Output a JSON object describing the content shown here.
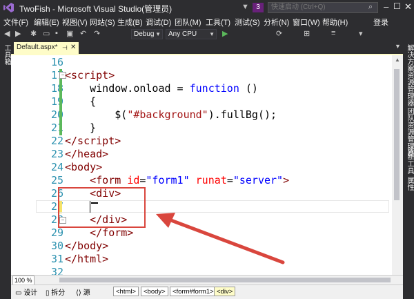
{
  "window": {
    "title": "TwoFish - Microsoft Visual Studio(管理员)",
    "notification_count": "3",
    "quick_launch_placeholder": "快速启动 (Ctrl+Q)"
  },
  "menu": {
    "items": [
      "文件(F)",
      "编辑(E)",
      "视图(V)",
      "网站(S)",
      "生成(B)",
      "调试(D)",
      "团队(M)",
      "工具(T)",
      "测试(S)",
      "分析(N)",
      "窗口(W)",
      "帮助(H)"
    ],
    "login": "登录"
  },
  "toolbar": {
    "configuration": "Debug",
    "platform": "Any CPU"
  },
  "side_panels": {
    "left": "工具箱",
    "right": [
      "解决方案资源管理器",
      "团队资源管理器",
      "诊断工具",
      "属性"
    ]
  },
  "tab": {
    "label": "Default.aspx*"
  },
  "code": {
    "line_numbers": [
      "16",
      "17",
      "18",
      "19",
      "20",
      "21",
      "22",
      "23",
      "24",
      "25",
      "26",
      "27",
      "28",
      "29",
      "30",
      "31",
      "32"
    ]
  },
  "bottom": {
    "zoom": "100 %"
  },
  "status": {
    "design": "设计",
    "split": "拆分",
    "source": "源",
    "breadcrumbs": [
      "<html>",
      "<body>",
      "<form#form1>",
      "<div>"
    ]
  },
  "colors": {
    "chrome": "#2d2d30",
    "accent_purple": "#68217a",
    "tab_yellow": "#fefcc8",
    "highlight_red": "#d9463d"
  }
}
